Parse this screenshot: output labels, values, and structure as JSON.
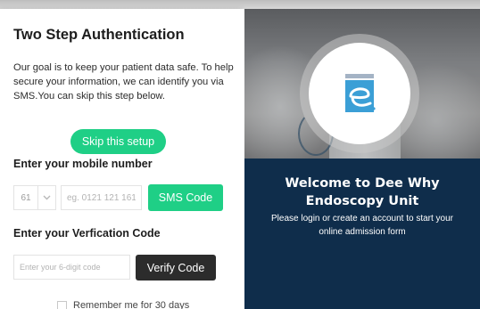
{
  "auth": {
    "title": "Two Step Authentication",
    "intro": "Our goal is to keep your patient data safe. To help secure your information, we can identify you via SMS.You can skip this step below.",
    "skip_label": "Skip this setup",
    "mobile_heading": "Enter your mobile number",
    "country_code": "61",
    "phone_placeholder": "eg. 0121 121 161",
    "sms_label": "SMS Code",
    "verify_heading": "Enter your Verfication Code",
    "code_placeholder": "Enter your 6-digit code",
    "verify_label": "Verify Code",
    "remember_label": "Remember me for 30 days"
  },
  "welcome": {
    "title": "Welcome to Dee Why Endoscopy Unit",
    "subtitle": "Please login or create an account to start your online admission form"
  },
  "colors": {
    "accent_green": "#1fcf86",
    "dark_button": "#2c2c2c",
    "navy_panel": "#0f2d4b",
    "logo_blue": "#3b9fd6"
  },
  "icons": {
    "dropdown": "chevron-down-icon",
    "logo": "e-logo-icon"
  }
}
